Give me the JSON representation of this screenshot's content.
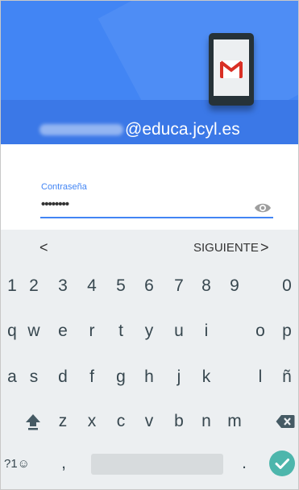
{
  "header": {
    "account_domain": "@educa.jcyl.es"
  },
  "form": {
    "password_label": "Contraseña",
    "password_value": "••••••••"
  },
  "suggestions": {
    "back": "<",
    "next_label": "SIGUIENTE",
    "next_arrow": ">"
  },
  "keyboard": {
    "numbers": [
      "1",
      "2",
      "3",
      "4",
      "5",
      "6",
      "7",
      "8",
      "9",
      "0"
    ],
    "row1": [
      "q",
      "w",
      "e",
      "r",
      "t",
      "y",
      "u",
      "i",
      "o",
      "p"
    ],
    "row2": [
      "a",
      "s",
      "d",
      "f",
      "g",
      "h",
      "j",
      "k",
      "l",
      "ñ"
    ],
    "row3": [
      "z",
      "x",
      "c",
      "v",
      "b",
      "n",
      "m"
    ],
    "symbols_key": "?1☺",
    "comma_key": ",",
    "period_key": "."
  },
  "colors": {
    "accent": "#4285f4",
    "enter_key": "#4db6ac",
    "keyboard_bg": "#eceff1"
  },
  "icons": [
    "gmail-phone-icon",
    "eye-icon",
    "shift-icon",
    "backspace-icon",
    "check-icon"
  ]
}
